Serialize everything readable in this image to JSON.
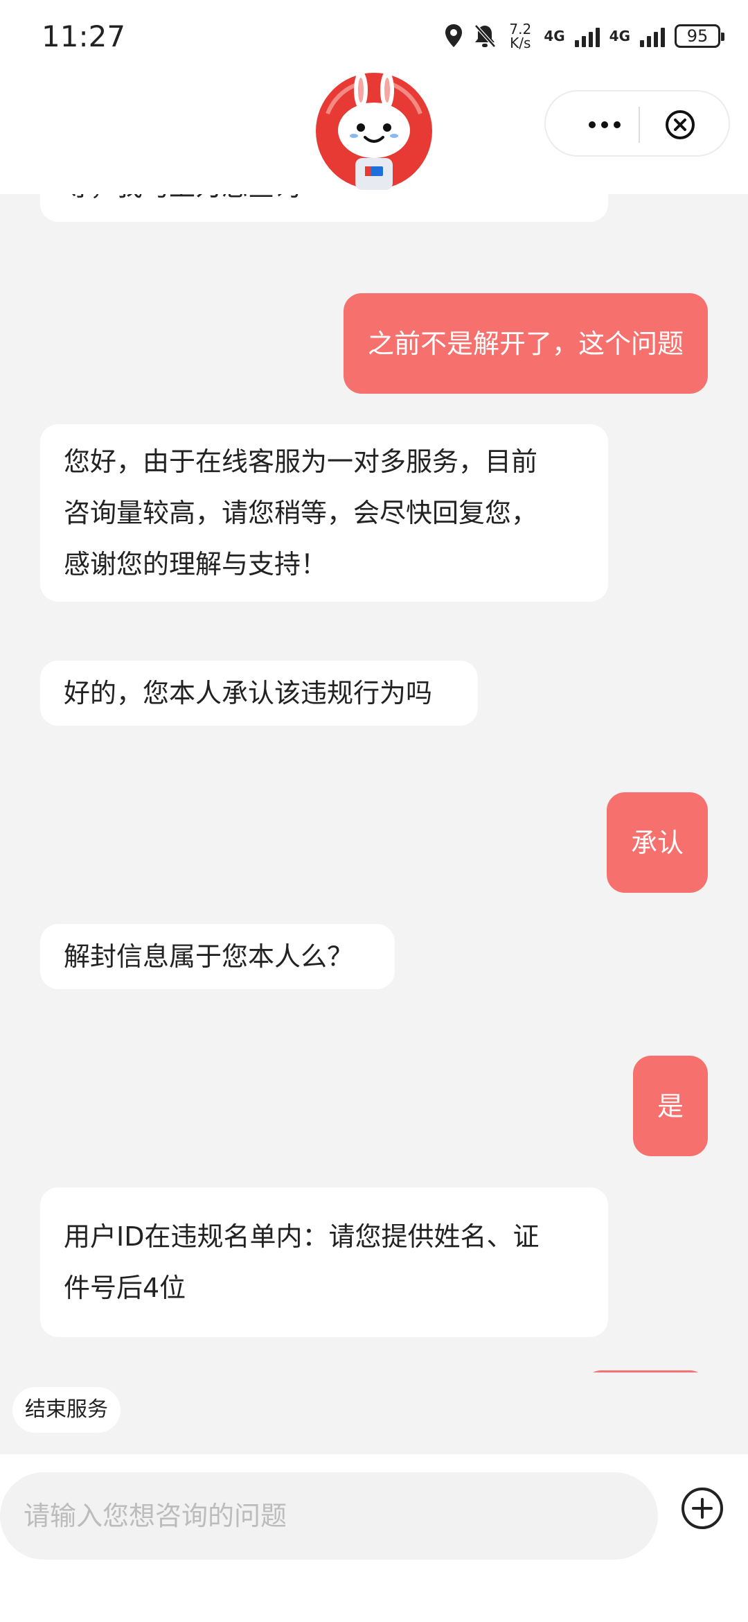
{
  "status_bar": {
    "time": "11:27",
    "speed_value": "7.2",
    "speed_unit": "K/s",
    "network_1": "4G",
    "network_2": "4G",
    "battery": "95",
    "icons": [
      "location-icon",
      "bell-muted-icon",
      "signal-icon",
      "battery-icon"
    ]
  },
  "header": {
    "avatar_icon": "rabbit-mascot-icon",
    "more_icon": "more-icon",
    "close_icon": "close-circle-icon"
  },
  "messages": [
    {
      "from": "agent",
      "lines": [
        "等，我马上为您查询~"
      ]
    },
    {
      "from": "user",
      "lines": [
        "之前不是解开了，这个问题"
      ]
    },
    {
      "from": "agent",
      "lines": [
        "您好，由于在线客服为一对多服务，目前",
        "咨询量较高，请您稍等，会尽快回复您，",
        "感谢您的理解与支持！"
      ]
    },
    {
      "from": "agent",
      "lines": [
        "好的，您本人承认该违规行为吗"
      ]
    },
    {
      "from": "user",
      "lines": [
        "承认"
      ]
    },
    {
      "from": "agent",
      "lines": [
        "解封信息属于您本人么？"
      ]
    },
    {
      "from": "user",
      "lines": [
        "是"
      ]
    },
    {
      "from": "agent",
      "lines": [
        "用户ID在违规名单内：请您提供姓名、证",
        "件号后4位"
      ]
    }
  ],
  "quick_action": {
    "end_service": "结束服务"
  },
  "composer": {
    "placeholder": "请输入您想咨询的问题",
    "add_icon": "plus-circle-icon"
  },
  "colors": {
    "user_bubble": "#f6716d",
    "agent_bubble": "#ffffff",
    "chat_background": "#f3f3f3"
  }
}
